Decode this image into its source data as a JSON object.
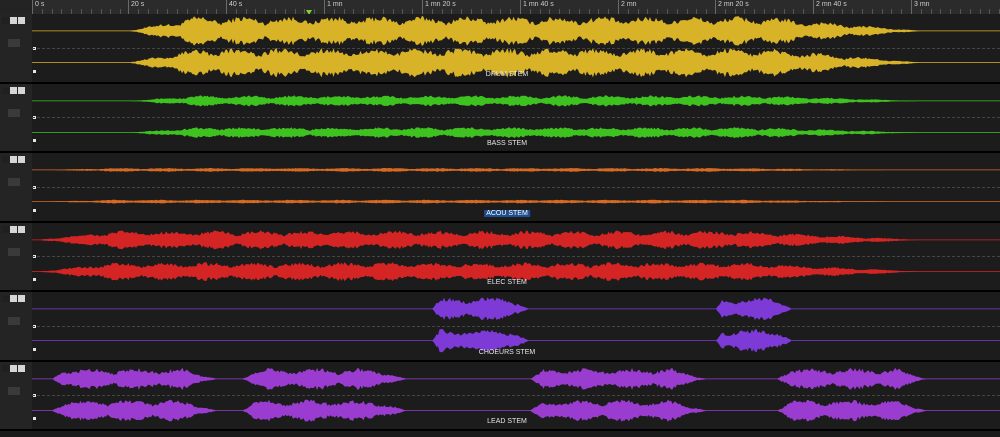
{
  "ruler": {
    "labels": [
      "0 s",
      "20 s",
      "40 s",
      "1 mn",
      "1 mn 20 s",
      "1 mn 40 s",
      "2 mn",
      "2 mn 20 s",
      "2 mn 40 s",
      "3 mn"
    ]
  },
  "track_controls": {
    "arrow": "▼",
    "b": "B",
    "s": "S",
    "fx": "0 fx",
    "pan": "Lf : Rf"
  },
  "tracks": [
    {
      "name": "Piste 1",
      "number": "1",
      "clip": "DRUM STEM",
      "color": "#d8b227",
      "selected": false
    },
    {
      "name": "Piste 2",
      "number": "2",
      "clip": "BASS STEM",
      "color": "#3ec21f",
      "selected": false
    },
    {
      "name": "Piste 3",
      "number": "3",
      "clip": "ACOU STEM",
      "color": "#d66a22",
      "selected": true
    },
    {
      "name": "Piste 4",
      "number": "4",
      "clip": "ELEC STEM",
      "color": "#d42424",
      "selected": false
    },
    {
      "name": "Piste 5",
      "number": "5",
      "clip": "CHOEURS STEM",
      "color": "#7d3ad6",
      "selected": false
    },
    {
      "name": "Piste 6",
      "number": "6",
      "clip": "LEAD STEM",
      "color": "#9a3ccf",
      "selected": false
    }
  ]
}
